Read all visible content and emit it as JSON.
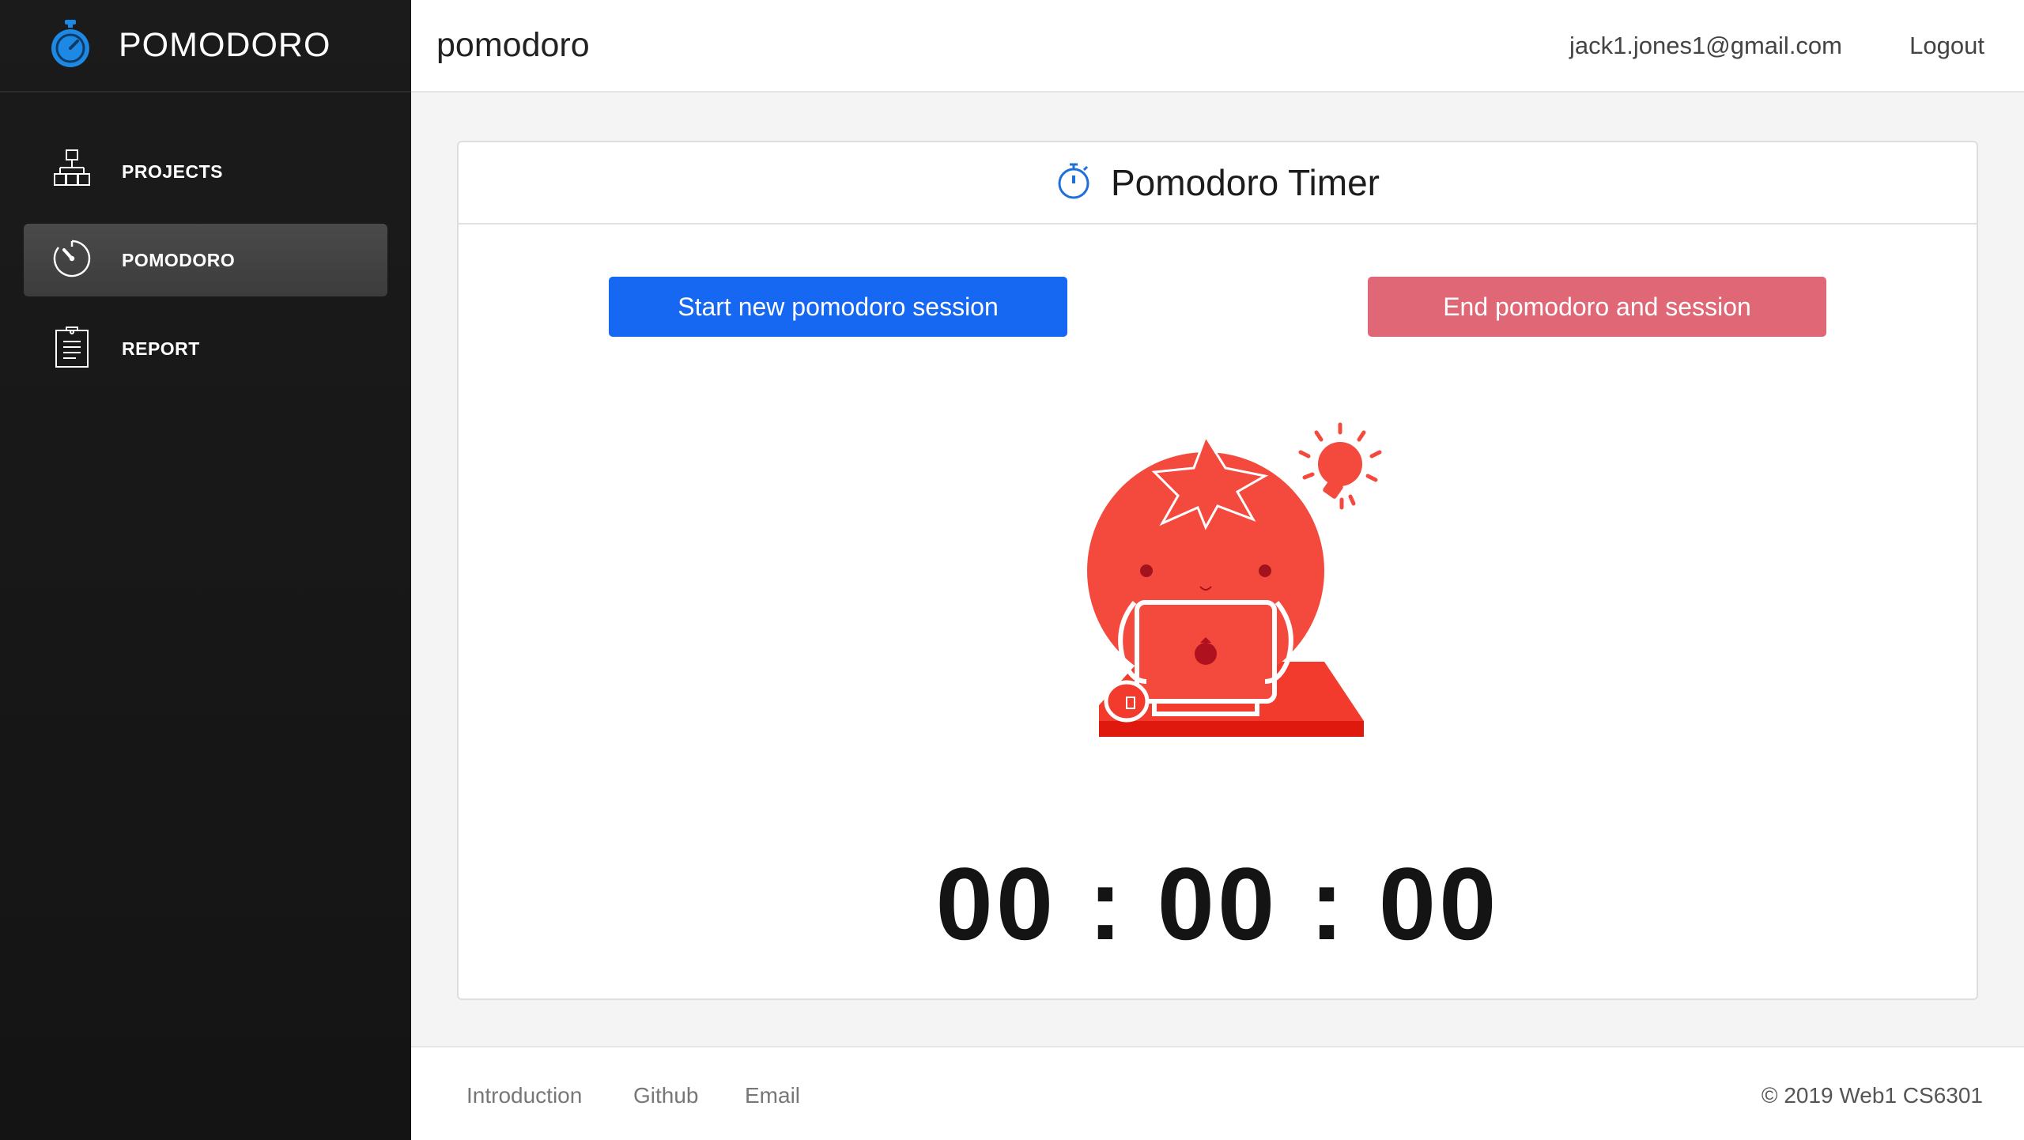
{
  "app": {
    "brand": "POMODORO",
    "brand_icon": "stopwatch-icon",
    "accent_color": "#1668f2"
  },
  "sidebar": {
    "items": [
      {
        "label": "PROJECTS",
        "icon": "sitemap-icon",
        "active": false
      },
      {
        "label": "POMODORO",
        "icon": "timer-icon",
        "active": true
      },
      {
        "label": "REPORT",
        "icon": "clipboard-icon",
        "active": false
      }
    ]
  },
  "header": {
    "title": "pomodoro",
    "email": "jack1.jones1@gmail.com",
    "logout": "Logout"
  },
  "card": {
    "title": "Pomodoro Timer",
    "title_icon": "stopwatch-icon",
    "start_button": "Start new pomodoro session",
    "end_button": "End pomodoro and session",
    "start_color": "#1668f2",
    "end_color": "#e06775",
    "illustration": "tomato-laptop-illustration",
    "timer": "00 : 00 : 00"
  },
  "footer": {
    "links": [
      "Introduction",
      "Github",
      "Email"
    ],
    "copyright": "© 2019 Web1 CS6301"
  }
}
